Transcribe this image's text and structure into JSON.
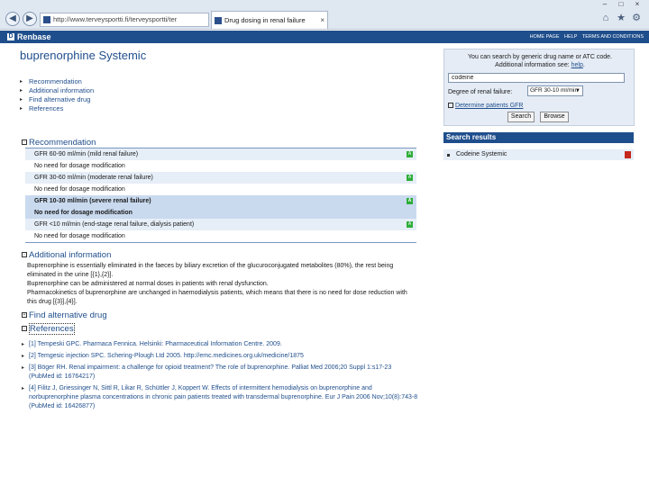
{
  "browser": {
    "url": "http://www.terveysportti.fi/terveysportti/ter",
    "tab_title": "Drug dosing in renal failure",
    "tab_close": "×",
    "back_icon": "back-arrow-icon",
    "forward_icon": "forward-arrow-icon",
    "window_controls": [
      "–",
      "□",
      "×"
    ],
    "tool_icons": [
      "home-icon",
      "star-icon",
      "gear-icon"
    ]
  },
  "site": {
    "logo": "D",
    "brand": "Renbase",
    "top_links": [
      "HOME PAGE",
      "HELP",
      "TERMS AND CONDITIONS"
    ]
  },
  "main": {
    "title": "buprenorphine Systemic",
    "toc": [
      "Recommendation",
      "Additional information",
      "Find alternative drug",
      "References"
    ],
    "recommendation": {
      "heading": "Recommendation",
      "rows": [
        {
          "text": "GFR 60-90 ml/min (mild renal failure)",
          "badge": "A"
        },
        {
          "text": "No need for dosage modification",
          "badge": ""
        },
        {
          "text": "GFR 30-60 ml/min (moderate renal failure)",
          "badge": "A"
        },
        {
          "text": "No need for dosage modification",
          "badge": ""
        },
        {
          "text": "GFR 10-30 ml/min (severe renal failure)",
          "badge": "A"
        },
        {
          "text": "No need for dosage modification",
          "badge": ""
        },
        {
          "text": "GFR <10 ml/min (end-stage renal failure, dialysis patient)",
          "badge": "A"
        },
        {
          "text": "No need for dosage modification",
          "badge": ""
        }
      ]
    },
    "additional": {
      "heading": "Additional information",
      "paragraphs": [
        "Buprenorphine is essentially eliminated in the faeces by biliary excretion of the glucuroconjugated metabolites (80%), the rest being eliminated in the urine [{1},{2}].",
        "Buprenorphine can be administered at normal doses in patients with renal dysfunction.",
        "Pharmacokinetics of buprenorphine are unchanged in haemodialysis patients, which means that there is no need for dose reduction with this drug [{3}],{4}]."
      ]
    },
    "alternative_heading": "Find alternative drug",
    "references_heading": "References",
    "references": [
      "[1] Tempeski GPC. Pharmaca Fennica. Helsinki: Pharmaceutical Information Centre. 2009.",
      "[2] Temgesic injection SPC. Schering-Plough Ltd 2005. http://emc.medicines.org.uk/medicine/1875",
      "[3] Böger RH. Renal impairment: a challenge for opioid treatment? The role of buprenorphine. Palliat Med 2006;20 Suppl 1:s17-23 (PubMed id: 16764217)",
      "[4] Filitz J, Griessinger N, Sittl R, Likar R, Schüttler J, Koppert W. Effects of intermittent hemodialysis on buprenorphine and norbuprenorphine plasma concentrations in chronic pain patients treated with transdermal buprenorphine. Eur J Pain 2006 Nov;10(8):743-8 (PubMed id: 16426877)"
    ]
  },
  "search": {
    "intro": "You can search by generic drug name or ATC code.",
    "more_info_prefix": "Additional information see:",
    "help_link": "help",
    "input_value": "codeine",
    "renal_label": "Degree of renal failure:",
    "renal_value": "GFR 30-10 ml/min",
    "gfr_link": "Determine patients GFR",
    "search_button": "Search",
    "browse_button": "Browse"
  },
  "results": {
    "heading": "Search results",
    "items": [
      "Codeine Systemic"
    ]
  },
  "colors": {
    "brand": "#1f4e8c",
    "highlight_row": "#c9daef",
    "badge_green": "#2fae3a",
    "badge_red": "#c4281c"
  }
}
